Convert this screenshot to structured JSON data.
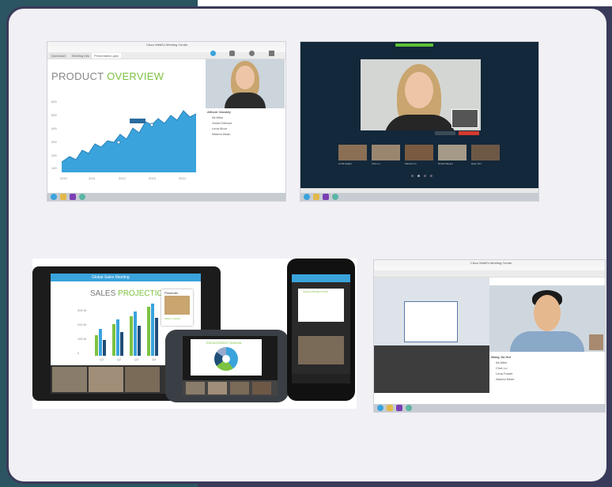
{
  "screens": {
    "desktop_overview": {
      "window_title": "Cisco WebEx Meeting Center",
      "tabs": [
        "Quickstart",
        "Meeting Info",
        "Presentation.pptx"
      ],
      "slide_title_part1": "PRODUCT ",
      "slide_title_part2": "OVERVIEW",
      "chart_y_labels": [
        "600",
        "500",
        "400",
        "300",
        "200",
        "100"
      ],
      "chart_x_labels": [
        "2010",
        "2011",
        "2012",
        "2013",
        "2014"
      ],
      "participant_name": "Allison Cassidy",
      "participants": [
        "Ali Allen",
        "Vivian Delcour",
        "Lena Moor",
        "Warren Bean"
      ]
    },
    "video_fullscreen": {
      "thumb_labels": [
        "Linda Haight",
        "Clive Lo",
        "Marisol Lin",
        "Rohan Bayers",
        "Ryan Kim"
      ]
    },
    "tablet": {
      "meeting_title": "Global Sales Meeting",
      "slide_title_part1": "SALES ",
      "slide_title_part2": "PROJECTIONS",
      "presenter_label": "Presenter",
      "presenter_name": "Allison Cassidy",
      "y_labels": [
        "300 M",
        "200 M",
        "100 M",
        "0"
      ],
      "x_labels": [
        "Q1",
        "Q2",
        "Q3",
        "Q4"
      ]
    },
    "android": {
      "slide_title": "ENGAGEMENT ANNUAL"
    },
    "iphone": {
      "slide_title": "SALES PROJECTIONS"
    },
    "desktop_sharing": {
      "window_title": "Cisco WebEx Meeting Center",
      "participants": [
        "Wang Jia Hui",
        "Ali Allen",
        "Clive Lo",
        "Lena Foster",
        "Warren Bean"
      ]
    }
  },
  "colors": {
    "outer_frame": "#3a3a5a",
    "teal_band": "#2b5560",
    "card_bg": "#f1f0f5",
    "webex_blue": "#3aa3dc",
    "slide_green": "#7dc242"
  }
}
